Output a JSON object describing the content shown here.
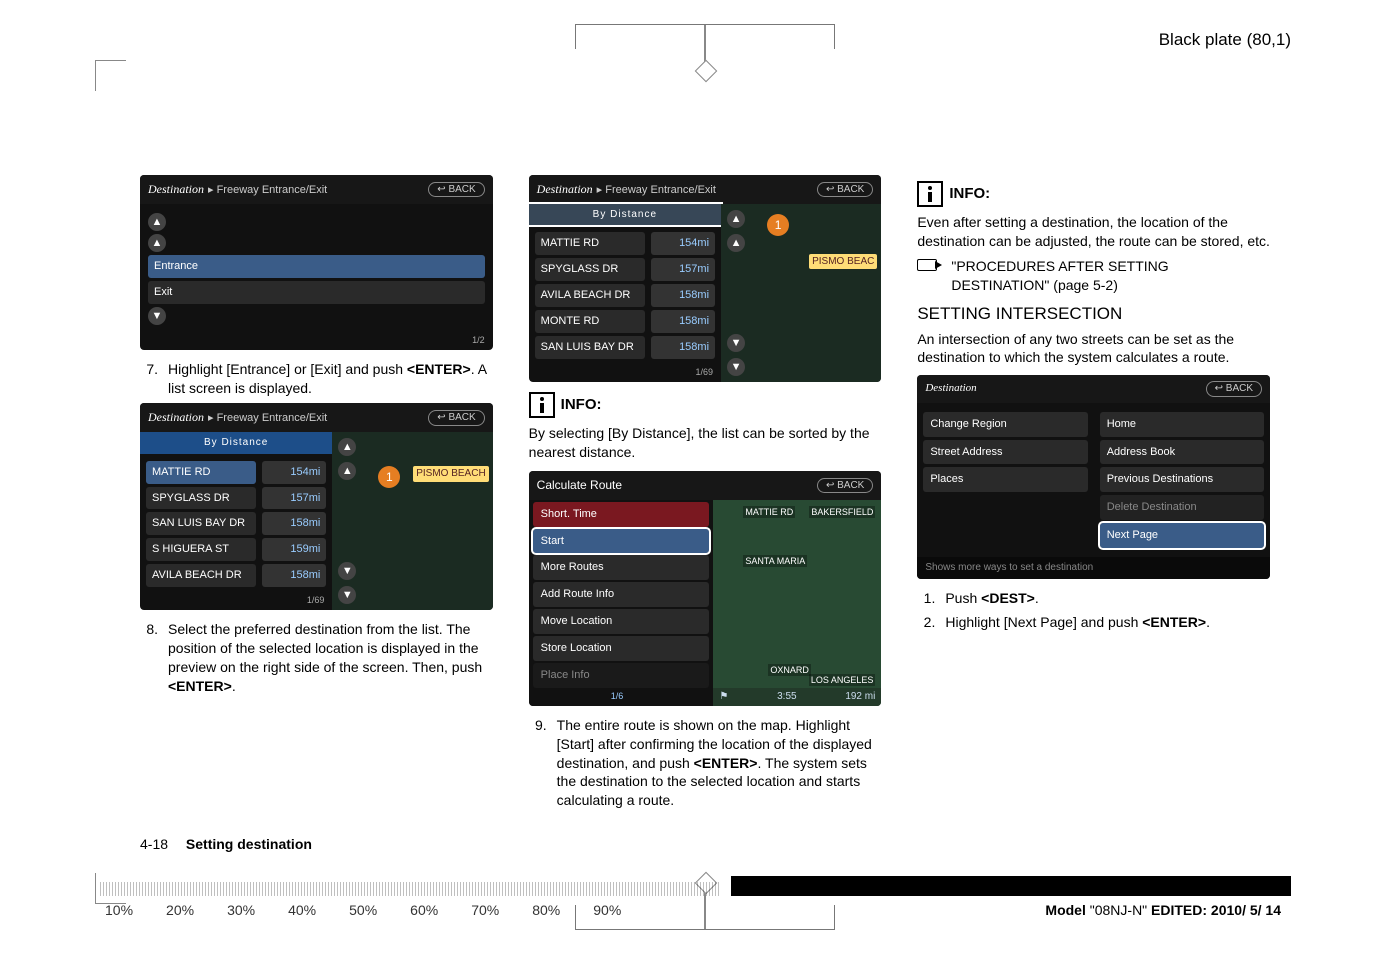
{
  "header": {
    "plate": "Black plate (80,1)"
  },
  "col1": {
    "shot_a": {
      "title": "Destination",
      "sub": "▸ Freeway Entrance/Exit",
      "back": "↩ BACK",
      "rows": [
        "Entrance",
        "Exit"
      ],
      "page": "1/2"
    },
    "step7_num": "7.",
    "step7": "Highlight [Entrance] or [Exit] and push <ENTER>. A list screen is displayed.",
    "shot_b": {
      "title": "Destination",
      "sub": "▸ Freeway Entrance/Exit",
      "back": "↩ BACK",
      "sort": "By Distance",
      "rows": [
        {
          "n": "MATTIE RD",
          "d": "154mi"
        },
        {
          "n": "SPYGLASS DR",
          "d": "157mi"
        },
        {
          "n": "SAN LUIS BAY DR",
          "d": "158mi"
        },
        {
          "n": "S HIGUERA ST",
          "d": "159mi"
        },
        {
          "n": "AVILA BEACH DR",
          "d": "158mi"
        }
      ],
      "count": "1/69",
      "map_flag": "PISMO BEACH"
    },
    "step8_num": "8.",
    "step8": "Select the preferred destination from the list. The position of the selected location is displayed in the preview on the right side of the screen. Then, push <ENTER>."
  },
  "col2": {
    "shot_c": {
      "title": "Destination",
      "sub": "▸ Freeway Entrance/Exit",
      "back": "↩ BACK",
      "sort": "By Distance",
      "rows": [
        {
          "n": "MATTIE RD",
          "d": "154mi"
        },
        {
          "n": "SPYGLASS DR",
          "d": "157mi"
        },
        {
          "n": "AVILA BEACH DR",
          "d": "158mi"
        },
        {
          "n": "MONTE RD",
          "d": "158mi"
        },
        {
          "n": "SAN LUIS BAY DR",
          "d": "158mi"
        }
      ],
      "count": "1/69",
      "map_flag": "PISMO BEAC"
    },
    "info1_title": "INFO:",
    "info1_body": "By selecting [By Distance], the list can be sorted by the nearest distance.",
    "shot_d": {
      "title": "Calculate Route",
      "back": "↩ BACK",
      "items": [
        "Short. Time",
        "Start",
        "More Routes",
        "Add Route Info",
        "Move Location",
        "Store Location",
        "Place Info"
      ],
      "page": "1/6",
      "map_labels": [
        "MATTIE RD",
        "BAKERSFIELD",
        "SANTA MARIA",
        "OXNARD",
        "LOS ANGELES"
      ],
      "bot_left": "⚑",
      "bot_time": "3:55",
      "bot_dist": "192 mi"
    },
    "step9_num": "9.",
    "step9": "The entire route is shown on the map. Highlight [Start] after confirming the location of the displayed destination, and push <ENTER>. The system sets the destination to the selected location and starts calculating a route."
  },
  "col3": {
    "info2_title": "INFO:",
    "info2_body": "Even after setting a destination, the location of the destination can be adjusted, the route can be stored, etc.",
    "ref": "\"PROCEDURES AFTER SETTING DESTINATION\" (page 5-2)",
    "section": "SETTING INTERSECTION",
    "intro": "An intersection of any two streets can be set as the destination to which the system calculates a route.",
    "shot_e": {
      "title": "Destination",
      "back": "↩ BACK",
      "left": [
        "Change Region",
        "Street Address",
        "Places"
      ],
      "right": [
        "Home",
        "Address Book",
        "Previous Destinations",
        "Delete Destination",
        "Next Page"
      ],
      "foot": "Shows more ways to set a destination"
    },
    "step1_num": "1.",
    "step1": "Push <DEST>.",
    "step2_num": "2.",
    "step2": "Highlight [Next Page] and push <ENTER>."
  },
  "footer": {
    "page": "4-18",
    "label": "Setting destination"
  },
  "percents": [
    "10%",
    "20%",
    "30%",
    "40%",
    "50%",
    "60%",
    "70%",
    "80%",
    "90%"
  ],
  "model": {
    "a": "Model ",
    "b": "\"08NJ-N\"",
    "c": "   EDITED:  2010/ 5/ 14"
  }
}
